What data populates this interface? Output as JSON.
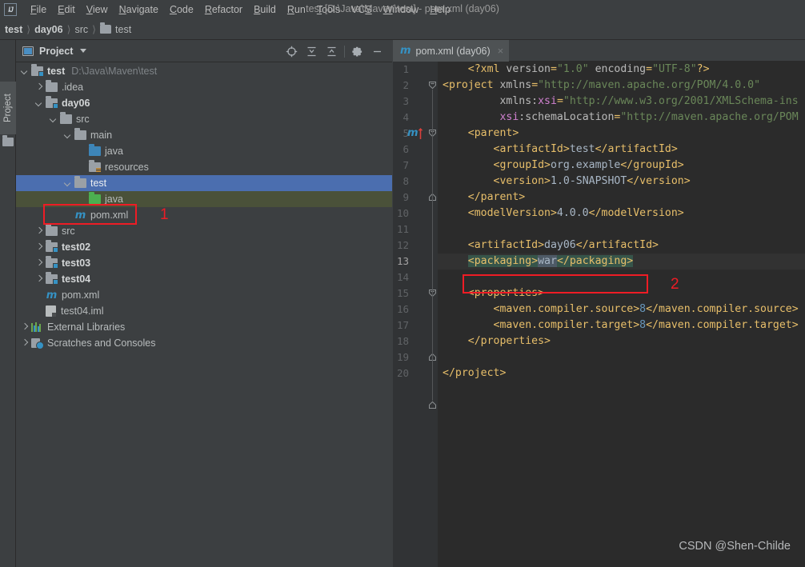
{
  "window": {
    "title": "test [D:\\Java\\Maven\\test] - pom.xml (day06)",
    "logo": "IJ"
  },
  "menubar": {
    "items": [
      {
        "label": "File",
        "mnemonic": "F"
      },
      {
        "label": "Edit",
        "mnemonic": "E"
      },
      {
        "label": "View",
        "mnemonic": "V"
      },
      {
        "label": "Navigate",
        "mnemonic": "N"
      },
      {
        "label": "Code",
        "mnemonic": "C"
      },
      {
        "label": "Refactor",
        "mnemonic": "R"
      },
      {
        "label": "Build",
        "mnemonic": "B"
      },
      {
        "label": "Run",
        "mnemonic": "R"
      },
      {
        "label": "Tools",
        "mnemonic": "T"
      },
      {
        "label": "VCS",
        "mnemonic": "S"
      },
      {
        "label": "Window",
        "mnemonic": "W"
      },
      {
        "label": "Help",
        "mnemonic": "H"
      }
    ]
  },
  "breadcrumb": {
    "items": [
      "test",
      "day06",
      "src",
      "test"
    ],
    "separator": "〉"
  },
  "toolstrip": {
    "project_tab_label": "Project"
  },
  "project_panel": {
    "title": "Project",
    "tools": [
      {
        "name": "select-opened-file-icon",
        "tooltip": "Select Opened File"
      },
      {
        "name": "expand-all-icon",
        "tooltip": "Expand All"
      },
      {
        "name": "collapse-all-icon",
        "tooltip": "Collapse All"
      },
      {
        "name": "gear-icon",
        "tooltip": "Settings"
      },
      {
        "name": "hide-icon",
        "tooltip": "Hide"
      }
    ],
    "tree": [
      {
        "indent": 0,
        "arrow": "down",
        "icon": "folder-module",
        "label": "test",
        "bold": true,
        "path": "D:\\Java\\Maven\\test",
        "state": "none"
      },
      {
        "indent": 1,
        "arrow": "right",
        "icon": "folder",
        "label": ".idea",
        "bold": false,
        "path": "",
        "state": "none"
      },
      {
        "indent": 1,
        "arrow": "down",
        "icon": "folder-module",
        "label": "day06",
        "bold": true,
        "path": "",
        "state": "none"
      },
      {
        "indent": 2,
        "arrow": "down",
        "icon": "folder",
        "label": "src",
        "bold": false,
        "path": "",
        "state": "none"
      },
      {
        "indent": 3,
        "arrow": "down",
        "icon": "folder",
        "label": "main",
        "bold": false,
        "path": "",
        "state": "none"
      },
      {
        "indent": 4,
        "arrow": "none",
        "icon": "folder-source",
        "label": "java",
        "bold": false,
        "path": "",
        "state": "none"
      },
      {
        "indent": 4,
        "arrow": "none",
        "icon": "folder-res",
        "label": "resources",
        "bold": false,
        "path": "",
        "state": "none"
      },
      {
        "indent": 3,
        "arrow": "down",
        "icon": "folder",
        "label": "test",
        "bold": false,
        "path": "",
        "state": "selected"
      },
      {
        "indent": 4,
        "arrow": "none",
        "icon": "folder-test",
        "label": "java",
        "bold": false,
        "path": "",
        "state": "testroot"
      },
      {
        "indent": 3,
        "arrow": "none",
        "icon": "maven",
        "label": "pom.xml",
        "bold": false,
        "path": "",
        "state": "none"
      },
      {
        "indent": 1,
        "arrow": "right",
        "icon": "folder",
        "label": "src",
        "bold": false,
        "path": "",
        "state": "none"
      },
      {
        "indent": 1,
        "arrow": "right",
        "icon": "folder-module",
        "label": "test02",
        "bold": true,
        "path": "",
        "state": "none"
      },
      {
        "indent": 1,
        "arrow": "right",
        "icon": "folder-module",
        "label": "test03",
        "bold": true,
        "path": "",
        "state": "none"
      },
      {
        "indent": 1,
        "arrow": "right",
        "icon": "folder-module",
        "label": "test04",
        "bold": true,
        "path": "",
        "state": "none"
      },
      {
        "indent": 1,
        "arrow": "none",
        "icon": "maven",
        "label": "pom.xml",
        "bold": false,
        "path": "",
        "state": "none"
      },
      {
        "indent": 1,
        "arrow": "none",
        "icon": "iml",
        "label": "test04.iml",
        "bold": false,
        "path": "",
        "state": "none"
      },
      {
        "indent": 0,
        "arrow": "right",
        "icon": "library",
        "label": "External Libraries",
        "bold": false,
        "path": "",
        "state": "none"
      },
      {
        "indent": 0,
        "arrow": "right",
        "icon": "scratch",
        "label": "Scratches and Consoles",
        "bold": false,
        "path": "",
        "state": "none"
      }
    ]
  },
  "editor": {
    "tab": {
      "label": "pom.xml (day06)",
      "icon": "maven-icon",
      "close": "×"
    },
    "current_line": 13,
    "lines": [
      {
        "n": 1,
        "fragments": [
          {
            "t": "    ",
            "c": "txt"
          },
          {
            "t": "<?xml",
            "c": "kw"
          },
          {
            "t": " ",
            "c": "txt"
          },
          {
            "t": "version",
            "c": "attr"
          },
          {
            "t": "=",
            "c": "kw"
          },
          {
            "t": "\"1.0\"",
            "c": "str"
          },
          {
            "t": " ",
            "c": "txt"
          },
          {
            "t": "encoding",
            "c": "attr"
          },
          {
            "t": "=",
            "c": "kw"
          },
          {
            "t": "\"UTF-8\"",
            "c": "str"
          },
          {
            "t": "?>",
            "c": "kw"
          }
        ]
      },
      {
        "n": 2,
        "fragments": [
          {
            "t": "<project",
            "c": "kw"
          },
          {
            "t": " ",
            "c": "txt"
          },
          {
            "t": "xmlns",
            "c": "attr"
          },
          {
            "t": "=",
            "c": "kw"
          },
          {
            "t": "\"http://maven.apache.org/POM/4.0.0\"",
            "c": "str"
          }
        ]
      },
      {
        "n": 3,
        "fragments": [
          {
            "t": "         ",
            "c": "txt"
          },
          {
            "t": "xmlns:",
            "c": "attr"
          },
          {
            "t": "xsi",
            "c": "attrx"
          },
          {
            "t": "=",
            "c": "kw"
          },
          {
            "t": "\"http://www.w3.org/2001/XMLSchema-ins",
            "c": "str"
          }
        ]
      },
      {
        "n": 4,
        "fragments": [
          {
            "t": "         ",
            "c": "txt"
          },
          {
            "t": "xsi",
            "c": "attrx"
          },
          {
            "t": ":schemaLocation",
            "c": "attr"
          },
          {
            "t": "=",
            "c": "kw"
          },
          {
            "t": "\"http://maven.apache.org/POM",
            "c": "str"
          }
        ]
      },
      {
        "n": 5,
        "fragments": [
          {
            "t": "    ",
            "c": "txt"
          },
          {
            "t": "<parent>",
            "c": "kw"
          }
        ]
      },
      {
        "n": 6,
        "fragments": [
          {
            "t": "        ",
            "c": "txt"
          },
          {
            "t": "<artifactId>",
            "c": "kw"
          },
          {
            "t": "test",
            "c": "txt"
          },
          {
            "t": "</artifactId>",
            "c": "kw"
          }
        ]
      },
      {
        "n": 7,
        "fragments": [
          {
            "t": "        ",
            "c": "txt"
          },
          {
            "t": "<groupId>",
            "c": "kw"
          },
          {
            "t": "org.example",
            "c": "txt"
          },
          {
            "t": "</groupId>",
            "c": "kw"
          }
        ]
      },
      {
        "n": 8,
        "fragments": [
          {
            "t": "        ",
            "c": "txt"
          },
          {
            "t": "<version>",
            "c": "kw"
          },
          {
            "t": "1.0-SNAPSHOT",
            "c": "txt"
          },
          {
            "t": "</version>",
            "c": "kw"
          }
        ]
      },
      {
        "n": 9,
        "fragments": [
          {
            "t": "    ",
            "c": "txt"
          },
          {
            "t": "</parent>",
            "c": "kw"
          }
        ]
      },
      {
        "n": 10,
        "fragments": [
          {
            "t": "    ",
            "c": "txt"
          },
          {
            "t": "<modelVersion>",
            "c": "kw"
          },
          {
            "t": "4.0.0",
            "c": "txt"
          },
          {
            "t": "</modelVersion>",
            "c": "kw"
          }
        ]
      },
      {
        "n": 11,
        "fragments": []
      },
      {
        "n": 12,
        "fragments": [
          {
            "t": "    ",
            "c": "txt"
          },
          {
            "t": "<artifactId>",
            "c": "kw"
          },
          {
            "t": "day06",
            "c": "txt"
          },
          {
            "t": "</artifactId>",
            "c": "kw"
          }
        ]
      },
      {
        "n": 13,
        "fragments": [
          {
            "t": "    ",
            "c": "txt"
          },
          {
            "t": "<packaging>",
            "c": "kw",
            "hl": "tag"
          },
          {
            "t": "war",
            "c": "txt",
            "hl": "val"
          },
          {
            "t": "</packaging>",
            "c": "kw",
            "hl": "tag"
          }
        ]
      },
      {
        "n": 14,
        "fragments": []
      },
      {
        "n": 15,
        "fragments": [
          {
            "t": "    ",
            "c": "txt"
          },
          {
            "t": "<properties>",
            "c": "kw"
          }
        ]
      },
      {
        "n": 16,
        "fragments": [
          {
            "t": "        ",
            "c": "txt"
          },
          {
            "t": "<maven.compiler.source>",
            "c": "kw"
          },
          {
            "t": "8",
            "c": "num"
          },
          {
            "t": "</maven.compiler.source>",
            "c": "kw"
          }
        ]
      },
      {
        "n": 17,
        "fragments": [
          {
            "t": "        ",
            "c": "txt"
          },
          {
            "t": "<maven.compiler.target>",
            "c": "kw"
          },
          {
            "t": "8",
            "c": "num"
          },
          {
            "t": "</maven.compiler.target>",
            "c": "kw"
          }
        ]
      },
      {
        "n": 18,
        "fragments": [
          {
            "t": "    ",
            "c": "txt"
          },
          {
            "t": "</properties>",
            "c": "kw"
          }
        ]
      },
      {
        "n": 19,
        "fragments": []
      },
      {
        "n": 20,
        "fragments": [
          {
            "t": "</project>",
            "c": "kw"
          }
        ]
      }
    ],
    "gutter_marker": {
      "line": 5,
      "icon": "maven-parent-icon",
      "glyph": "m"
    }
  },
  "annotations": [
    {
      "number": "1",
      "target": "pom.xml tree node"
    },
    {
      "number": "2",
      "target": "packaging element"
    }
  ],
  "watermark": "CSDN @Shen-Childe",
  "colors": {
    "accent": "#3592c4",
    "selection": "#4b6eaf",
    "test_root": "#4a5139",
    "annotation": "#ee1c25",
    "editor_bg": "#2b2b2b",
    "panel_bg": "#3c3f41"
  }
}
